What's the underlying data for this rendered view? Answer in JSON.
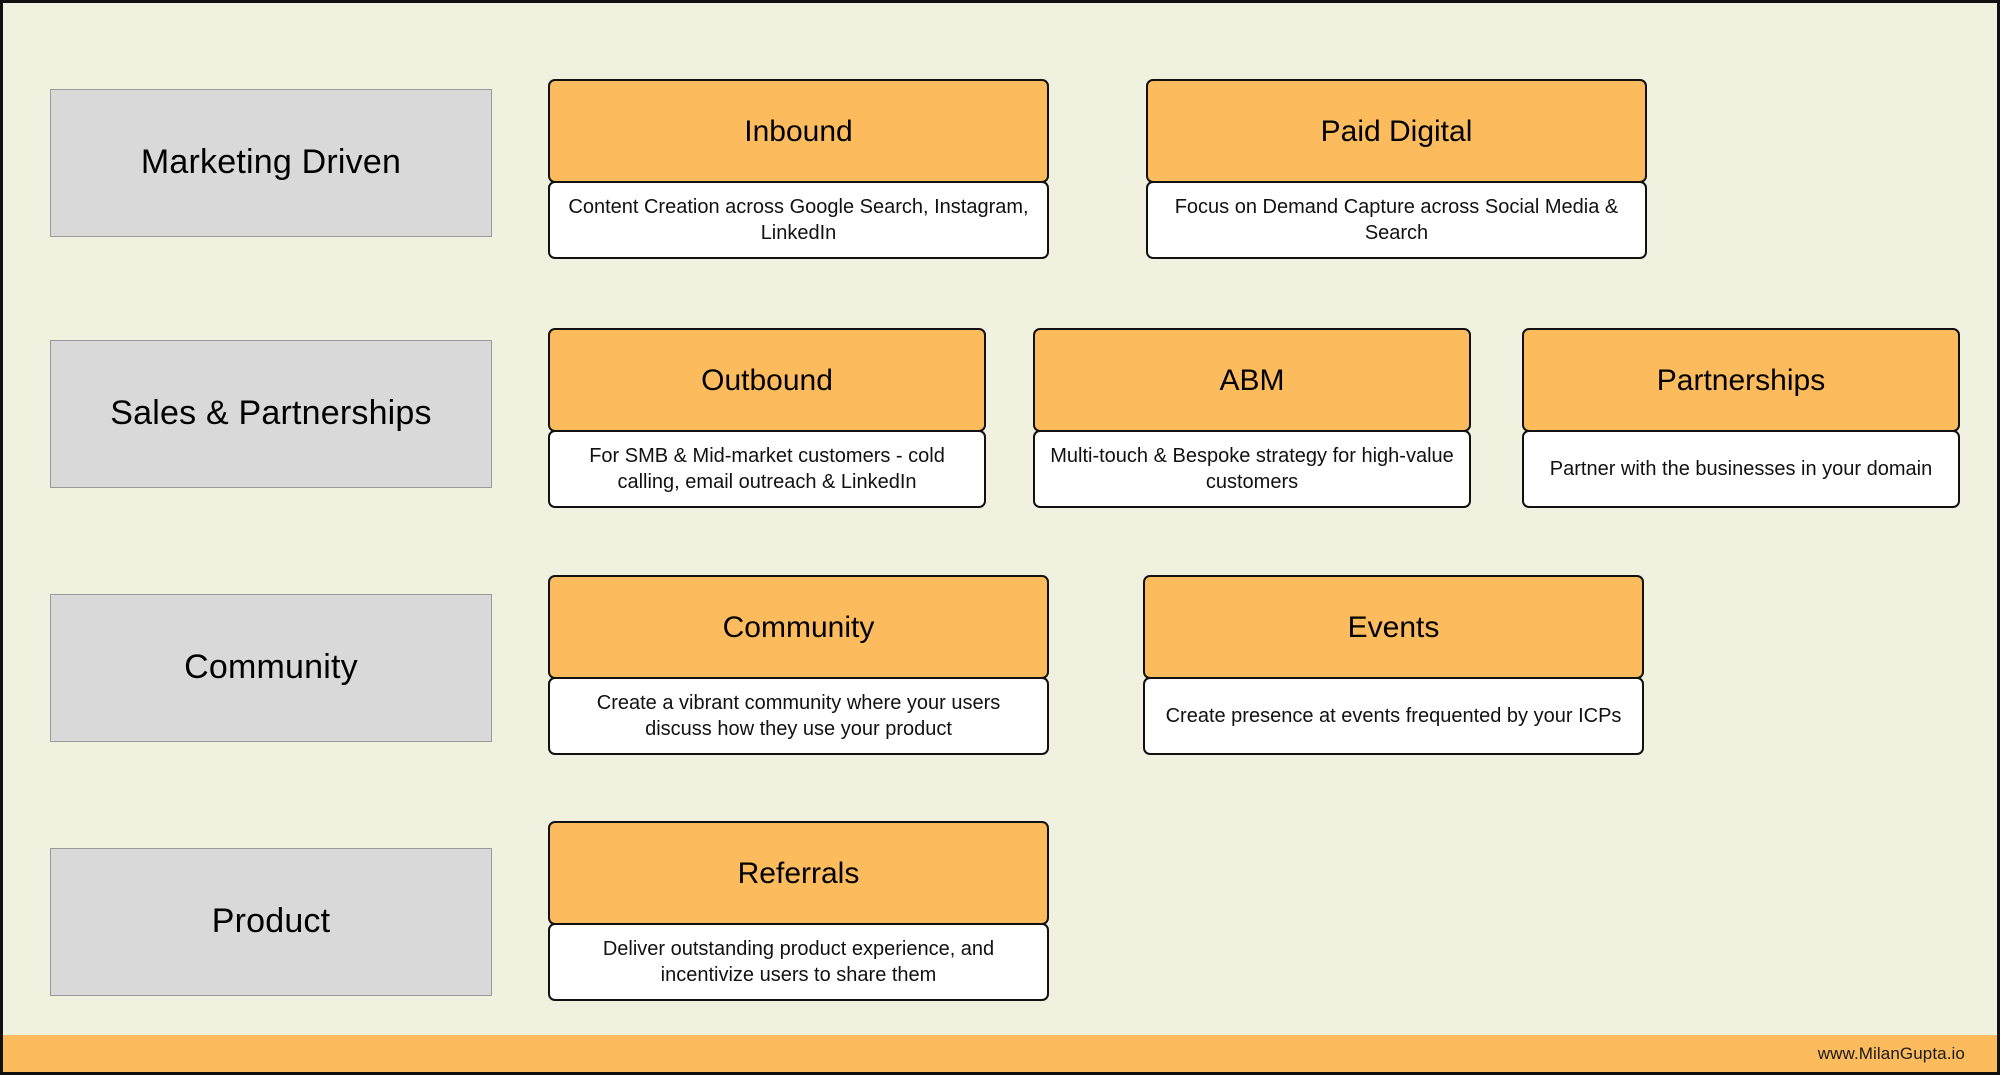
{
  "theme": {
    "background": "#F0F1DE",
    "accent_orange": "#FCBC5E",
    "category_gray": "#D9D9D9",
    "card_body_white": "#FFFFFF",
    "outline": "#111111"
  },
  "rows": [
    {
      "category": "Marketing Driven",
      "cards": [
        {
          "title": "Inbound",
          "description": "Content Creation across Google Search, Instagram, LinkedIn"
        },
        {
          "title": "Paid Digital",
          "description": "Focus on Demand Capture across Social Media & Search"
        }
      ]
    },
    {
      "category": "Sales & Partnerships",
      "cards": [
        {
          "title": "Outbound",
          "description": "For SMB & Mid-market customers - cold calling, email outreach & LinkedIn"
        },
        {
          "title": "ABM",
          "description": "Multi-touch & Bespoke strategy for high-value customers"
        },
        {
          "title": "Partnerships",
          "description": "Partner with the businesses in your domain"
        }
      ]
    },
    {
      "category": "Community",
      "cards": [
        {
          "title": "Community",
          "description": "Create a vibrant community where your users discuss how they use your product"
        },
        {
          "title": "Events",
          "description": "Create presence at events frequented by your ICPs"
        }
      ]
    },
    {
      "category": "Product",
      "cards": [
        {
          "title": "Referrals",
          "description": "Deliver outstanding product experience, and incentivize users to share them"
        }
      ]
    }
  ],
  "footer": {
    "url": "www.MilanGupta.io"
  }
}
